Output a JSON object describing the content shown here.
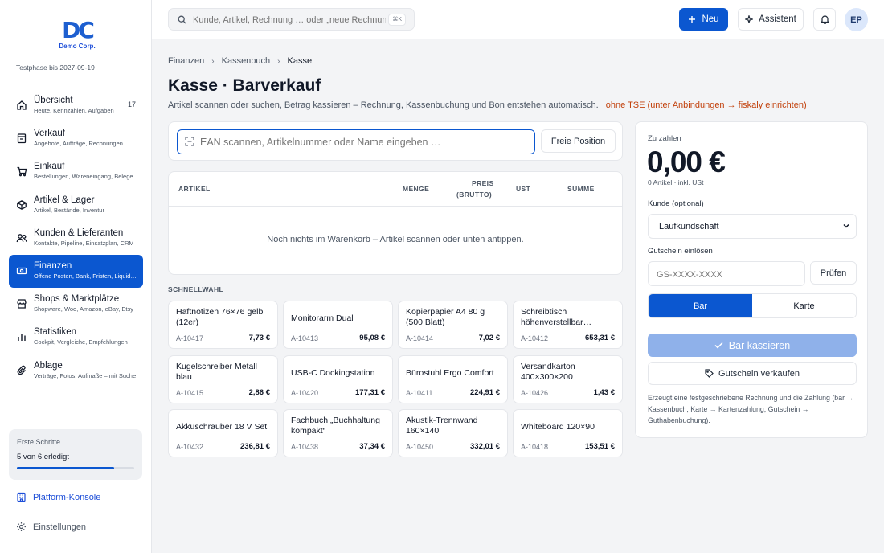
{
  "brand": {
    "logo_mark": "DC",
    "name": "Demo Corp.",
    "trial": "Testphase bis 2027-09-19"
  },
  "sidebar": {
    "items": [
      {
        "title": "Übersicht",
        "sub": "Heute, Kennzahlen, Aufgaben",
        "badge": "17",
        "icon": "home-icon"
      },
      {
        "title": "Verkauf",
        "sub": "Angebote, Aufträge, Rechnungen",
        "icon": "invoice-icon"
      },
      {
        "title": "Einkauf",
        "sub": "Bestellungen, Wareneingang, Belege",
        "icon": "cart-icon"
      },
      {
        "title": "Artikel & Lager",
        "sub": "Artikel, Bestände, Inventur",
        "icon": "box-icon"
      },
      {
        "title": "Kunden & Lieferanten",
        "sub": "Kontakte, Pipeline, Einsatzplan, CRM",
        "icon": "users-icon"
      },
      {
        "title": "Finanzen",
        "sub": "Offene Posten, Bank, Fristen, Liquidität",
        "icon": "cash-icon",
        "active": true
      },
      {
        "title": "Shops & Marktplätze",
        "sub": "Shopware, Woo, Amazon, eBay, Etsy",
        "icon": "shop-icon"
      },
      {
        "title": "Statistiken",
        "sub": "Cockpit, Vergleiche, Empfehlungen",
        "icon": "stats-icon"
      },
      {
        "title": "Ablage",
        "sub": "Verträge, Fotos, Aufmaße – mit Suche",
        "icon": "paperclip-icon"
      }
    ],
    "steps": {
      "title": "Erste Schritte",
      "count": "5 von 6 erledigt",
      "progress": 0.83
    },
    "console_label": "Platform-Konsole",
    "settings_label": "Einstellungen"
  },
  "topbar": {
    "search_placeholder": "Kunde, Artikel, Rechnung … oder „neue Rechnung“",
    "search_shortcut": "⌘K",
    "new_label": "Neu",
    "assistant_label": "Assistent",
    "avatar_initials": "EP"
  },
  "breadcrumb": [
    "Finanzen",
    "Kassenbuch",
    "Kasse"
  ],
  "page": {
    "title": "Kasse · Barverkauf",
    "subtitle": "Artikel scannen oder suchen, Betrag kassieren – Rechnung, Kassenbuchung und Bon entstehen automatisch.",
    "warning": "ohne TSE (unter Anbindungen → fiskaly einrichten)"
  },
  "scan": {
    "placeholder": "EAN scannen, Artikelnummer oder Name eingeben …",
    "free_label": "Freie Position"
  },
  "cart": {
    "columns": {
      "article": "ARTIKEL",
      "qty": "MENGE",
      "price1": "PREIS",
      "price2": "(BRUTTO)",
      "vat": "UST",
      "sum": "SUMME"
    },
    "empty": "Noch nichts im Warenkorb – Artikel scannen oder unten antippen."
  },
  "quick": {
    "label": "SCHNELLWAHL",
    "items": [
      {
        "name": "Haftnotizen 76×76 gelb (12er)",
        "sku": "A-10417",
        "price": "7,73 €"
      },
      {
        "name": "Monitorarm Dual",
        "sku": "A-10413",
        "price": "95,08 €"
      },
      {
        "name": "Kopierpapier A4 80 g (500 Blatt)",
        "sku": "A-10414",
        "price": "7,02 €"
      },
      {
        "name": "Schreibtisch höhenverstellbar…",
        "sku": "A-10412",
        "price": "653,31 €"
      },
      {
        "name": "Kugelschreiber Metall blau",
        "sku": "A-10415",
        "price": "2,86 €"
      },
      {
        "name": "USB-C Dockingstation",
        "sku": "A-10420",
        "price": "177,31 €"
      },
      {
        "name": "Bürostuhl Ergo Comfort",
        "sku": "A-10411",
        "price": "224,91 €"
      },
      {
        "name": "Versandkarton 400×300×200",
        "sku": "A-10426",
        "price": "1,43 €"
      },
      {
        "name": "Akkuschrauber 18 V Set",
        "sku": "A-10432",
        "price": "236,81 €"
      },
      {
        "name": "Fachbuch „Buchhaltung kompakt“",
        "sku": "A-10438",
        "price": "37,34 €"
      },
      {
        "name": "Akustik-Trennwand 160×140",
        "sku": "A-10450",
        "price": "332,01 €"
      },
      {
        "name": "Whiteboard 120×90",
        "sku": "A-10418",
        "price": "153,51 €"
      }
    ]
  },
  "pay": {
    "due_label": "Zu zahlen",
    "total": "0,00 €",
    "meta": "0 Artikel · inkl. USt",
    "customer_label": "Kunde (optional)",
    "customer_value": "Laufkundschaft",
    "voucher_label": "Gutschein einlösen",
    "voucher_placeholder": "GS-XXXX-XXXX",
    "check_label": "Prüfen",
    "method_cash": "Bar",
    "method_card": "Karte",
    "pay_button": "Bar kassieren",
    "gift_button": "Gutschein verkaufen",
    "note": "Erzeugt eine festgeschriebene Rechnung und die Zahlung (bar → Kassenbuch, Karte → Kartenzahlung, Gutschein → Guthabenbuchung)."
  },
  "colors": {
    "accent": "#0b57d0",
    "warning": "#c2410c",
    "disabled": "#8fb1ea"
  }
}
